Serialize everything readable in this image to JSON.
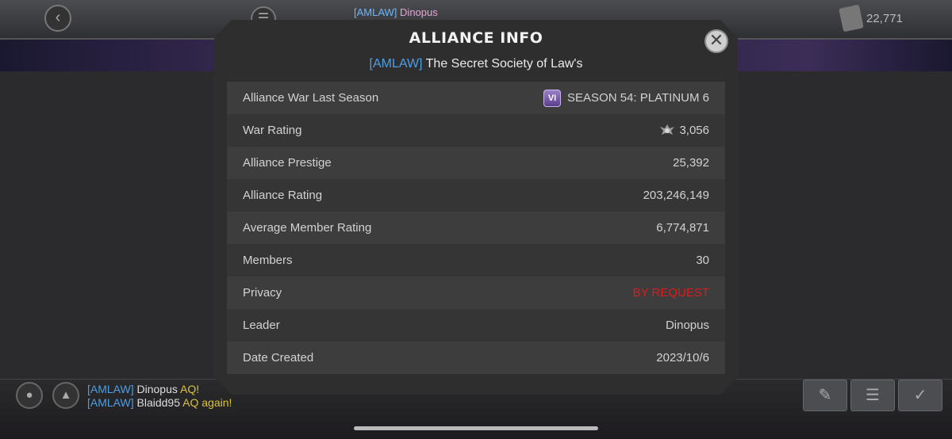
{
  "topbar": {
    "alliance_tag": "[AMLAW]",
    "player_name": "Dinopus",
    "currency_value": "22,771"
  },
  "chat": [
    {
      "tag": "[AMLAW]",
      "who": "Dinopus",
      "msg": "AQ!"
    },
    {
      "tag": "[AMLAW]",
      "who": "Blaidd95",
      "msg": "AQ again!"
    }
  ],
  "modal": {
    "title": "ALLIANCE INFO",
    "alliance_tag": "[AMLAW]",
    "alliance_name": "The Secret Society of Law's",
    "rows": [
      {
        "label": "Alliance War Last Season",
        "value": "SEASON 54: PLATINUM 6",
        "badge": "VI"
      },
      {
        "label": "War Rating",
        "value": "3,056"
      },
      {
        "label": "Alliance Prestige",
        "value": "25,392"
      },
      {
        "label": "Alliance Rating",
        "value": "203,246,149"
      },
      {
        "label": "Average Member Rating",
        "value": "6,774,871"
      },
      {
        "label": "Members",
        "value": "30"
      },
      {
        "label": "Privacy",
        "value": "BY REQUEST",
        "color": "#d61e1e"
      },
      {
        "label": "Leader",
        "value": "Dinopus"
      },
      {
        "label": "Date Created",
        "value": "2023/10/6"
      }
    ]
  }
}
